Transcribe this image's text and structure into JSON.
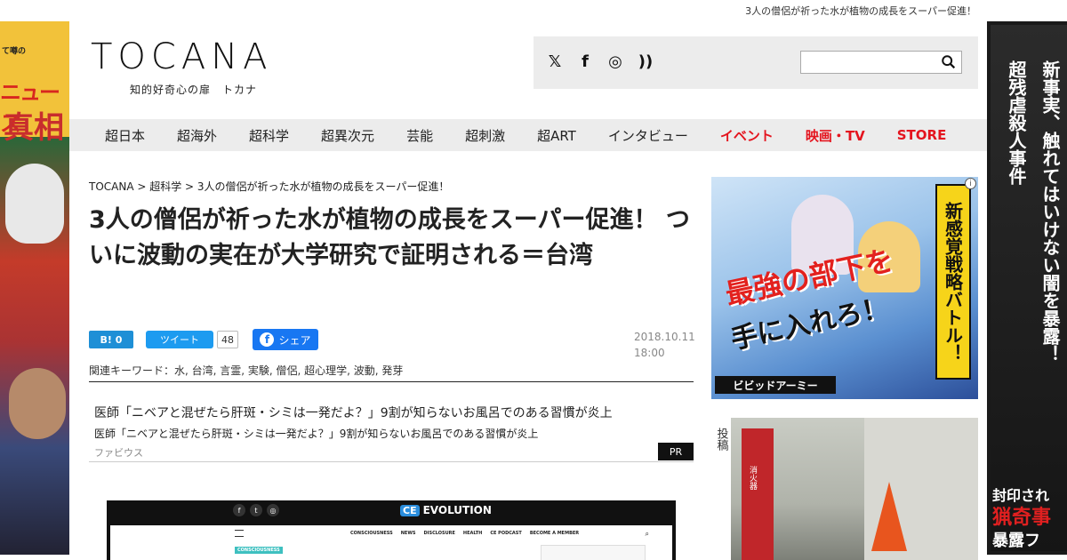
{
  "tagline": "3人の僧侶が祈った水が植物の成長をスーパー促進！",
  "logo": {
    "word": "TOCANA",
    "sub": "知的好奇心の扉　トカナ"
  },
  "social": {
    "twitter": "𝕏",
    "facebook": "f",
    "instagram": "◎",
    "rss": "))"
  },
  "search": {
    "value": "",
    "placeholder": ""
  },
  "nav": [
    {
      "label": "超日本",
      "red": false
    },
    {
      "label": "超海外",
      "red": false
    },
    {
      "label": "超科学",
      "red": false
    },
    {
      "label": "超異次元",
      "red": false
    },
    {
      "label": "芸能",
      "red": false
    },
    {
      "label": "超刺激",
      "red": false
    },
    {
      "label": "超ART",
      "red": false
    },
    {
      "label": "インタビュー",
      "red": false
    },
    {
      "label": "イベント",
      "red": true
    },
    {
      "label": "映画・TV",
      "red": true
    },
    {
      "label": "STORE",
      "red": true
    }
  ],
  "breadcrumb": "TOCANA > 超科学 > 3人の僧侶が祈った水が植物の成長をスーパー促進！",
  "article": {
    "title": "3人の僧侶が祈った水が植物の成長をスーパー促進！ ついに波動の実在が大学研究で証明される＝台湾",
    "date": "2018.10.11",
    "time": "18:00",
    "keywords": "関連キーワード：水, 台湾, 言霊, 実験, 僧侶, 超心理学, 波動, 発芽"
  },
  "share": {
    "hatena_label": "B! 0",
    "tweet_label": "ツイート",
    "tweet_count": "48",
    "fb_label": "シェア"
  },
  "pr": {
    "headline": "医師「ニベアと混ぜたら肝斑・シミは一発だよ？」9割が知らないお風呂でのある習慣が炎上",
    "subline": "医師「ニベアと混ぜたら肝斑・シミは一発だよ？」9割が知らないお風呂でのある習慣が炎上",
    "source": "ファビウス",
    "tag": "PR"
  },
  "embed": {
    "logo_text": "EVOLUTION",
    "logo_badge": "CE",
    "menu": [
      "CONSCIOUSNESS",
      "NEWS",
      "DISCLOSURE",
      "HEALTH",
      "CE PODCAST",
      "BECOME A MEMBER"
    ],
    "category": "CONSCIOUSNESS"
  },
  "ads": {
    "left": {
      "t1": "て噂の",
      "t2": "ニュース",
      "t3": "真相"
    },
    "right": {
      "col1": "超残虐殺人事件",
      "col2": "新事実、触れてはいけない闇を暴露！",
      "b1": "封印され",
      "b2": "猟奇事",
      "b3": "暴露フ"
    },
    "ad1": {
      "banner": "新感覚戦略バトル！",
      "big": "最強の部下を",
      "big2": "手に入れろ！",
      "brand": "ビビッドアーミー"
    },
    "post_label": "投稿",
    "ad2_box": "消火器"
  }
}
